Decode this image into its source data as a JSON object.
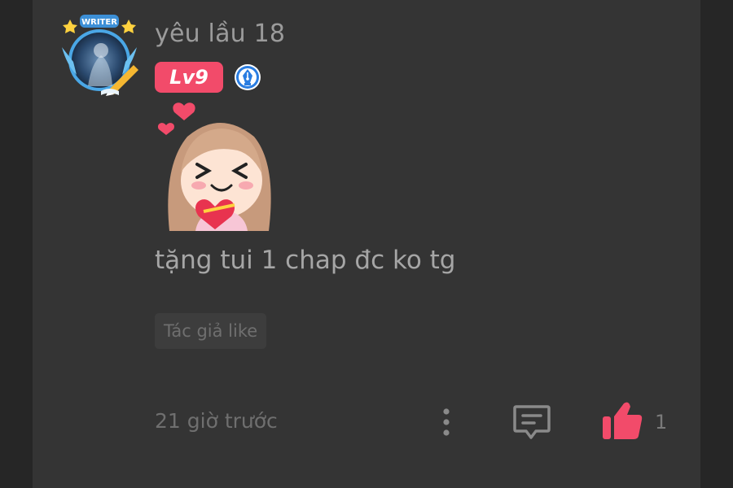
{
  "comment": {
    "username": "yêu lầu 18",
    "level": "Lv9",
    "avatar_frame_label": "WRITER",
    "text": "tặng tui 1 chap đc ko tg",
    "tag": "Tác giả like",
    "timestamp": "21 giờ trước",
    "like_count": "1"
  },
  "icons": {
    "writer_badge": "pen-nib-icon",
    "more": "vertical-dots-icon",
    "reply": "comment-bubble-icon",
    "like": "thumbs-up-icon"
  },
  "colors": {
    "background": "#262626",
    "card": "#343434",
    "level_badge": "#f24b6a",
    "like_active": "#f24b6a",
    "writer_badge": "#2a7de1"
  }
}
